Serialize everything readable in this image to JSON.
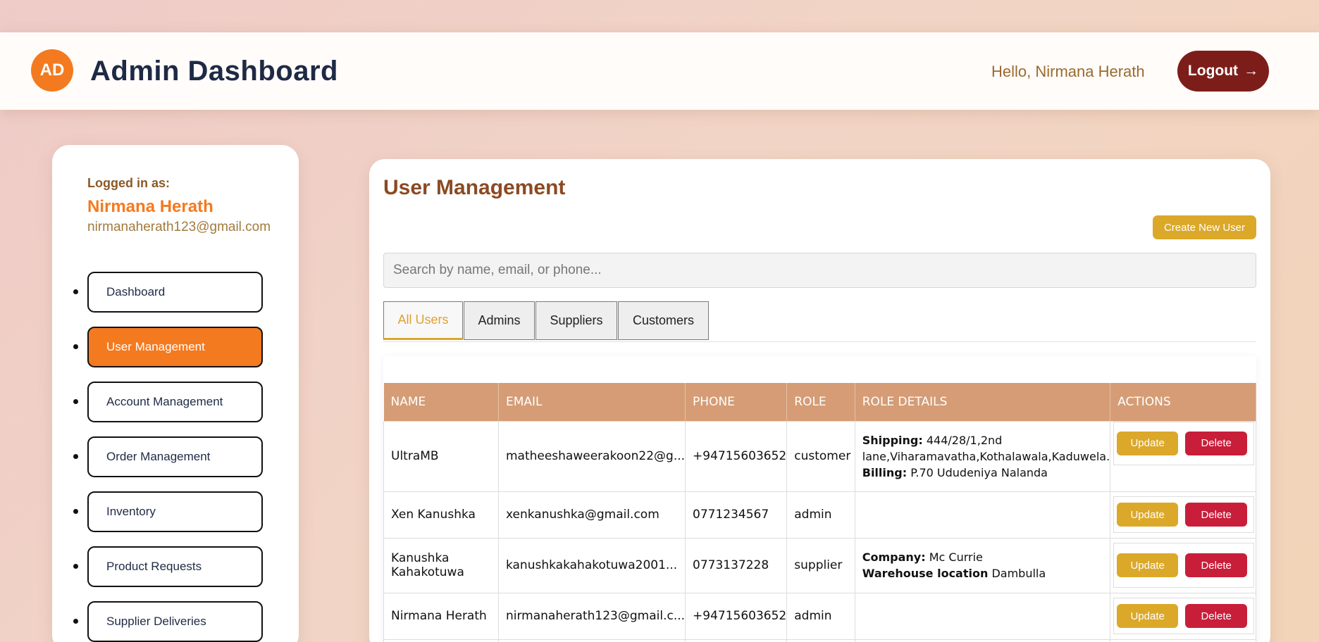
{
  "header": {
    "logo_initials": "AD",
    "title": "Admin Dashboard",
    "greeting": "Hello, Nirmana Herath",
    "logout_label": "Logout",
    "logout_arrow": "→"
  },
  "sidebar": {
    "logged_in_label": "Logged in as:",
    "user_name": "Nirmana Herath",
    "user_email": "nirmanaherath123@gmail.com",
    "items": [
      {
        "label": "Dashboard",
        "active": false
      },
      {
        "label": "User Management",
        "active": true
      },
      {
        "label": "Account Management",
        "active": false
      },
      {
        "label": "Order Management",
        "active": false
      },
      {
        "label": "Inventory",
        "active": false
      },
      {
        "label": "Product Requests",
        "active": false
      },
      {
        "label": "Supplier Deliveries",
        "active": false
      }
    ]
  },
  "main": {
    "title": "User Management",
    "create_button": "Create New User",
    "search_placeholder": "Search by name, email, or phone...",
    "tabs": [
      {
        "label": "All Users",
        "active": true
      },
      {
        "label": "Admins",
        "active": false
      },
      {
        "label": "Suppliers",
        "active": false
      },
      {
        "label": "Customers",
        "active": false
      }
    ],
    "table": {
      "columns": [
        "NAME",
        "EMAIL",
        "PHONE",
        "ROLE",
        "ROLE DETAILS",
        "ACTIONS"
      ],
      "update_label": "Update",
      "delete_label": "Delete",
      "rows": [
        {
          "name": "UltraMB",
          "email": "matheeshaweerakoon22@g...",
          "phone": "+94715603652",
          "role": "customer",
          "detail1_label": "Shipping:",
          "detail1_value": "444/28/1,2nd lane,Viharamavatha,Kothalawala,Kaduwela.",
          "detail2_label": "Billing:",
          "detail2_value": "P.70 Ududeniya Nalanda"
        },
        {
          "name": "Xen Kanushka",
          "email": "xenkanushka@gmail.com",
          "phone": "0771234567",
          "role": "admin"
        },
        {
          "name": "Kanushka Kahakotuwa",
          "email": "kanushkakahakotuwa2001...",
          "phone": "0773137228",
          "role": "supplier",
          "detail1_label": "Company:",
          "detail1_value": "Mc Currie",
          "detail2_label": "Warehouse location",
          "detail2_value": "Dambulla"
        },
        {
          "name": "Nirmana Herath",
          "email": "nirmanaherath123@gmail.c...",
          "phone": "+94715603652",
          "role": "admin"
        }
      ]
    }
  },
  "colors": {
    "accent_orange": "#f47a1f",
    "logout_bg": "#7d1d1a",
    "header_row": "#d59c75",
    "update_btn": "#dba82a",
    "delete_btn": "#c81e3a"
  }
}
